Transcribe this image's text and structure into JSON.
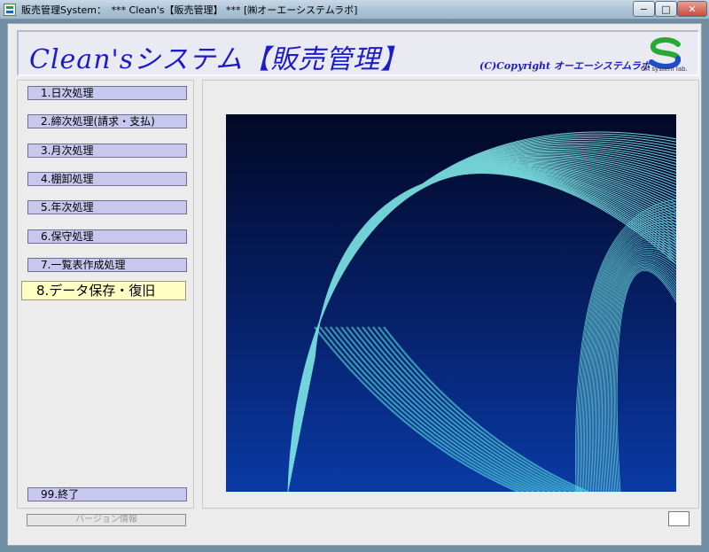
{
  "window": {
    "title": "販売管理System：　*** Clean's【販売管理】 *** [㈱オーエーシステムラボ]",
    "minimize_glyph": "−",
    "maximize_glyph": "□",
    "close_glyph": "✕"
  },
  "header": {
    "title": "Clean'sシステム【販売管理】",
    "copyright": "(C)Copyright オーエーシステムラボ",
    "logo_text": "OA system lab.",
    "logo_icon": "oa-system-logo",
    "colors": {
      "title": "#1b1bcc",
      "logo_green": "#2aa834",
      "logo_blue": "#1f4fc8"
    }
  },
  "menu": {
    "items": [
      {
        "label": "1.日次処理"
      },
      {
        "label": "2.締次処理(請求・支払)"
      },
      {
        "label": "3.月次処理"
      },
      {
        "label": "4.棚卸処理"
      },
      {
        "label": "5.年次処理"
      },
      {
        "label": "6.保守処理"
      },
      {
        "label": "7.一覧表作成処理"
      },
      {
        "label": "8.データ保存・復旧"
      }
    ],
    "exit_label": "99.終了",
    "active_index": 7,
    "colors": {
      "item_bg": "#c8c8ef",
      "active_bg": "#ffffc4"
    }
  },
  "footer": {
    "version_label": "バージョン情報"
  }
}
